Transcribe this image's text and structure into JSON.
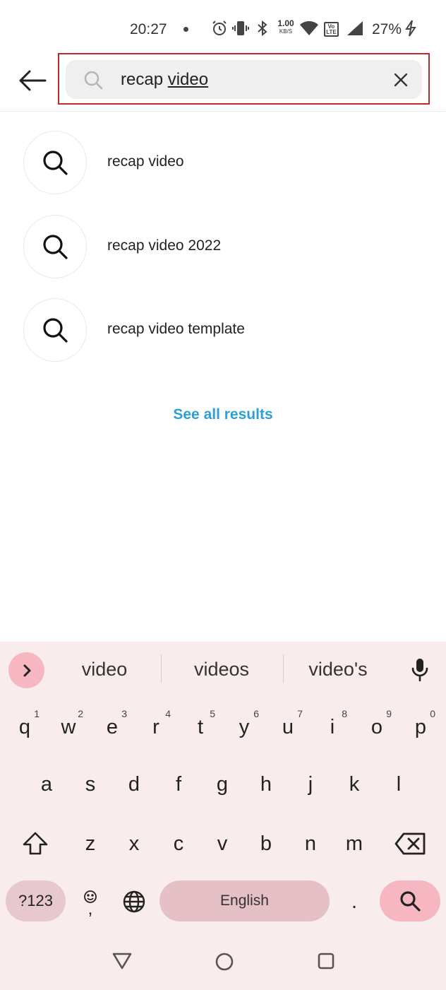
{
  "status_bar": {
    "time": "20:27",
    "net_speed_value": "1.00",
    "net_speed_unit": "KB/S",
    "volte": "Vo LTE",
    "battery": "27%"
  },
  "search": {
    "query_prefix": "recap ",
    "query_underlined": "video"
  },
  "suggestions": [
    {
      "label": "recap video"
    },
    {
      "label": "recap video 2022"
    },
    {
      "label": "recap video template"
    }
  ],
  "see_all": "See all results",
  "keyboard": {
    "suggestions": [
      "video",
      "videos",
      "video's"
    ],
    "row1": [
      "q",
      "w",
      "e",
      "r",
      "t",
      "y",
      "u",
      "i",
      "o",
      "p"
    ],
    "row1_hints": [
      "1",
      "2",
      "3",
      "4",
      "5",
      "6",
      "7",
      "8",
      "9",
      "0"
    ],
    "row2": [
      "a",
      "s",
      "d",
      "f",
      "g",
      "h",
      "j",
      "k",
      "l"
    ],
    "row3": [
      "z",
      "x",
      "c",
      "v",
      "b",
      "n",
      "m"
    ],
    "symbols_label": "?123",
    "comma": ",",
    "period": ".",
    "space_label": "English"
  }
}
